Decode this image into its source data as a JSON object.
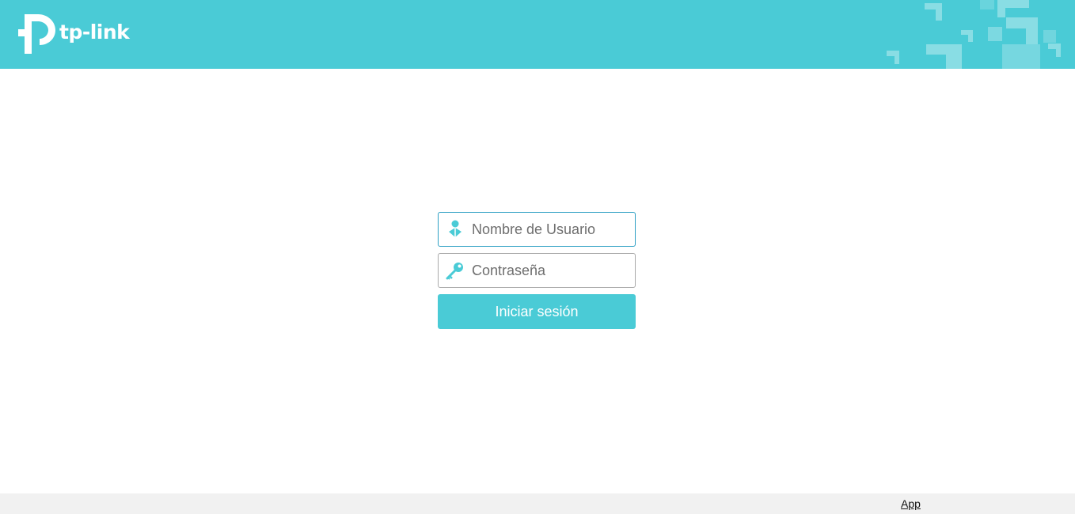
{
  "header": {
    "brand": "tp-link",
    "background_color": "#4acbd6"
  },
  "login": {
    "username_placeholder": "Nombre de Usuario",
    "username_icon": "user-icon",
    "password_placeholder": "Contraseña",
    "password_icon": "key-icon",
    "submit_label": "Iniciar sesión",
    "accent_color": "#4acbd6",
    "focus_border_color": "#2ea0c4"
  },
  "footer": {
    "app_link": "App",
    "background_color": "#f1f1f1"
  }
}
